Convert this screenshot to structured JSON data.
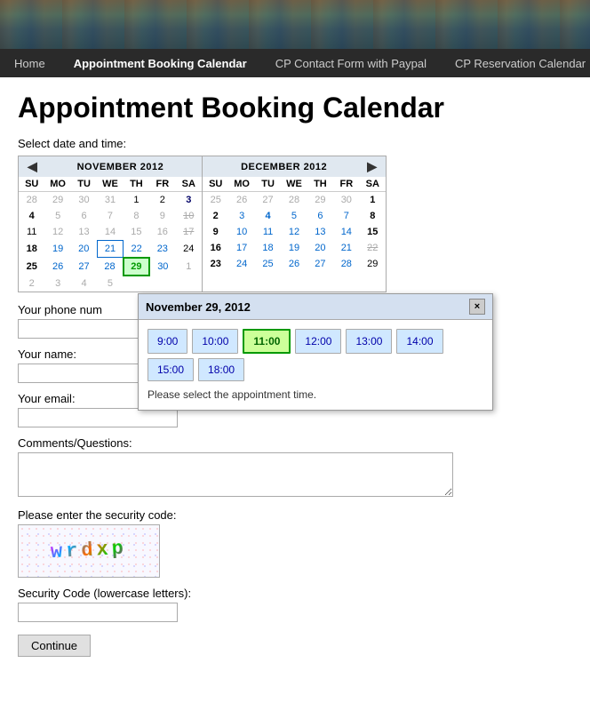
{
  "header": {
    "image_alt": "Rocky coastal landscape"
  },
  "navbar": {
    "items": [
      {
        "label": "Home",
        "active": false
      },
      {
        "label": "Appointment Booking Calendar",
        "active": true
      },
      {
        "label": "CP Contact Form with Paypal",
        "active": false
      },
      {
        "label": "CP Reservation Calendar",
        "active": false
      }
    ]
  },
  "page": {
    "title": "Appointment Booking Calendar",
    "select_label": "Select date and time:"
  },
  "calendar": {
    "left": {
      "month": "NOVEMBER 2012",
      "days_header": [
        "SU",
        "MO",
        "TU",
        "WE",
        "TH",
        "FR",
        "SA"
      ],
      "weeks": [
        [
          {
            "day": "28",
            "type": "other"
          },
          {
            "day": "29",
            "type": "other"
          },
          {
            "day": "30",
            "type": "other"
          },
          {
            "day": "31",
            "type": "other"
          },
          {
            "day": "1",
            "type": "current"
          },
          {
            "day": "2",
            "type": "current"
          },
          {
            "day": "3",
            "type": "current-bold-sat"
          }
        ],
        [
          {
            "day": "4",
            "type": "current-bold"
          },
          {
            "day": "5",
            "type": "other"
          },
          {
            "day": "6",
            "type": "other"
          },
          {
            "day": "7",
            "type": "other"
          },
          {
            "day": "8",
            "type": "other"
          },
          {
            "day": "9",
            "type": "other"
          },
          {
            "day": "10",
            "type": "current-strike"
          }
        ],
        [
          {
            "day": "11",
            "type": "current"
          },
          {
            "day": "12",
            "type": "other"
          },
          {
            "day": "13",
            "type": "other"
          },
          {
            "day": "14",
            "type": "other"
          },
          {
            "day": "15",
            "type": "other"
          },
          {
            "day": "16",
            "type": "other"
          },
          {
            "day": "17",
            "type": "current-strike"
          }
        ],
        [
          {
            "day": "18",
            "type": "current-bold"
          },
          {
            "day": "19",
            "type": "current-blue"
          },
          {
            "day": "20",
            "type": "current-blue"
          },
          {
            "day": "21",
            "type": "current-blue-circle"
          },
          {
            "day": "22",
            "type": "current-blue"
          },
          {
            "day": "23",
            "type": "current-blue"
          },
          {
            "day": "24",
            "type": "current"
          }
        ],
        [
          {
            "day": "25",
            "type": "current-bold"
          },
          {
            "day": "26",
            "type": "current-blue"
          },
          {
            "day": "27",
            "type": "current-blue"
          },
          {
            "day": "28",
            "type": "current-blue"
          },
          {
            "day": "29",
            "type": "current-green-selected"
          },
          {
            "day": "30",
            "type": "current-blue"
          },
          {
            "day": "1",
            "type": "other"
          }
        ],
        [
          {
            "day": "2",
            "type": "other"
          },
          {
            "day": "3",
            "type": "other"
          },
          {
            "day": "4",
            "type": "other"
          },
          {
            "day": "5",
            "type": "other"
          }
        ]
      ]
    },
    "right": {
      "month": "DECEMBER 2012",
      "days_header": [
        "SU",
        "MO",
        "TU",
        "WE",
        "TH",
        "FR",
        "SA"
      ],
      "weeks": [
        [
          {
            "day": "25",
            "type": "other"
          },
          {
            "day": "26",
            "type": "other"
          },
          {
            "day": "27",
            "type": "other"
          },
          {
            "day": "28",
            "type": "other"
          },
          {
            "day": "29",
            "type": "other"
          },
          {
            "day": "30",
            "type": "other"
          },
          {
            "day": "1",
            "type": "current-bold-sat"
          }
        ],
        [
          {
            "day": "2",
            "type": "current-bold"
          },
          {
            "day": "3",
            "type": "current-blue"
          },
          {
            "day": "4",
            "type": "current-blue-bold"
          },
          {
            "day": "5",
            "type": "current-blue"
          },
          {
            "day": "6",
            "type": "current-blue"
          },
          {
            "day": "7",
            "type": "current-blue"
          },
          {
            "day": "8",
            "type": "current-bold-sat"
          }
        ],
        [
          {
            "day": "9",
            "type": "current-bold"
          },
          {
            "day": "10",
            "type": "current-blue"
          },
          {
            "day": "11",
            "type": "current-blue"
          },
          {
            "day": "12",
            "type": "current-blue"
          },
          {
            "day": "13",
            "type": "current-blue"
          },
          {
            "day": "14",
            "type": "current-blue"
          },
          {
            "day": "15",
            "type": "current-bold-sat"
          }
        ],
        [
          {
            "day": "16",
            "type": "current-bold"
          },
          {
            "day": "17",
            "type": "current-blue"
          },
          {
            "day": "18",
            "type": "current-blue"
          },
          {
            "day": "19",
            "type": "current-blue"
          },
          {
            "day": "20",
            "type": "current-blue"
          },
          {
            "day": "21",
            "type": "current-blue"
          },
          {
            "day": "22",
            "type": "current-strike"
          }
        ],
        [
          {
            "day": "23",
            "type": "current-bold"
          },
          {
            "day": "24",
            "type": "current-blue"
          },
          {
            "day": "25",
            "type": "current-blue"
          },
          {
            "day": "26",
            "type": "current-blue"
          },
          {
            "day": "27",
            "type": "current-blue"
          },
          {
            "day": "28",
            "type": "current-blue"
          },
          {
            "day": "29",
            "type": "current"
          }
        ]
      ]
    }
  },
  "popup": {
    "title": "November 29, 2012",
    "close_label": "×",
    "time_slots": [
      {
        "time": "9:00",
        "selected": false
      },
      {
        "time": "10:00",
        "selected": false
      },
      {
        "time": "11:00",
        "selected": true
      },
      {
        "time": "12:00",
        "selected": false
      },
      {
        "time": "13:00",
        "selected": false
      },
      {
        "time": "14:00",
        "selected": false
      },
      {
        "time": "15:00",
        "selected": false
      },
      {
        "time": "18:00",
        "selected": false
      }
    ],
    "instruction": "Please select the appointment time."
  },
  "form": {
    "phone_label": "Your phone num",
    "phone_placeholder": "",
    "name_label": "Your name:",
    "name_placeholder": "",
    "email_label": "Your email:",
    "email_placeholder": "",
    "comments_label": "Comments/Questions:",
    "comments_placeholder": "",
    "security_label": "Please enter the security code:",
    "captcha_text": "wrdxp",
    "security_code_label": "Security Code (lowercase letters):",
    "security_code_placeholder": "",
    "continue_label": "Continue"
  }
}
